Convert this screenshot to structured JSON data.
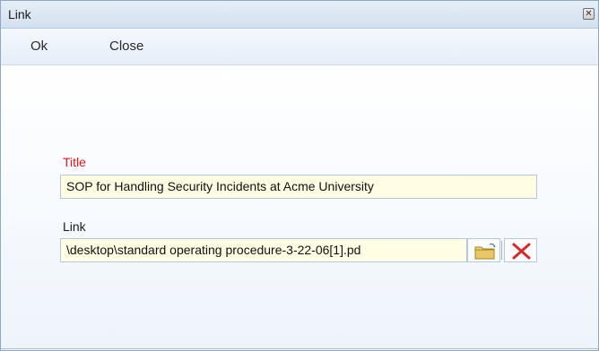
{
  "window": {
    "title": "Link",
    "close_glyph": "✕"
  },
  "toolbar": {
    "ok_label": "Ok",
    "close_label": "Close"
  },
  "form": {
    "title_label": "Title",
    "title_value": "SOP for Handling Security Incidents at Acme University",
    "link_label": "Link",
    "link_value": "\\desktop\\standard operating procedure-3-22-06[1].pd",
    "folder_icon": "folder-icon",
    "delete_icon": "delete-icon"
  },
  "colors": {
    "required_label": "#e01818",
    "field_background": "#fffde3",
    "delete_icon": "#d32b2b",
    "folder_icon": "#e8c766"
  }
}
